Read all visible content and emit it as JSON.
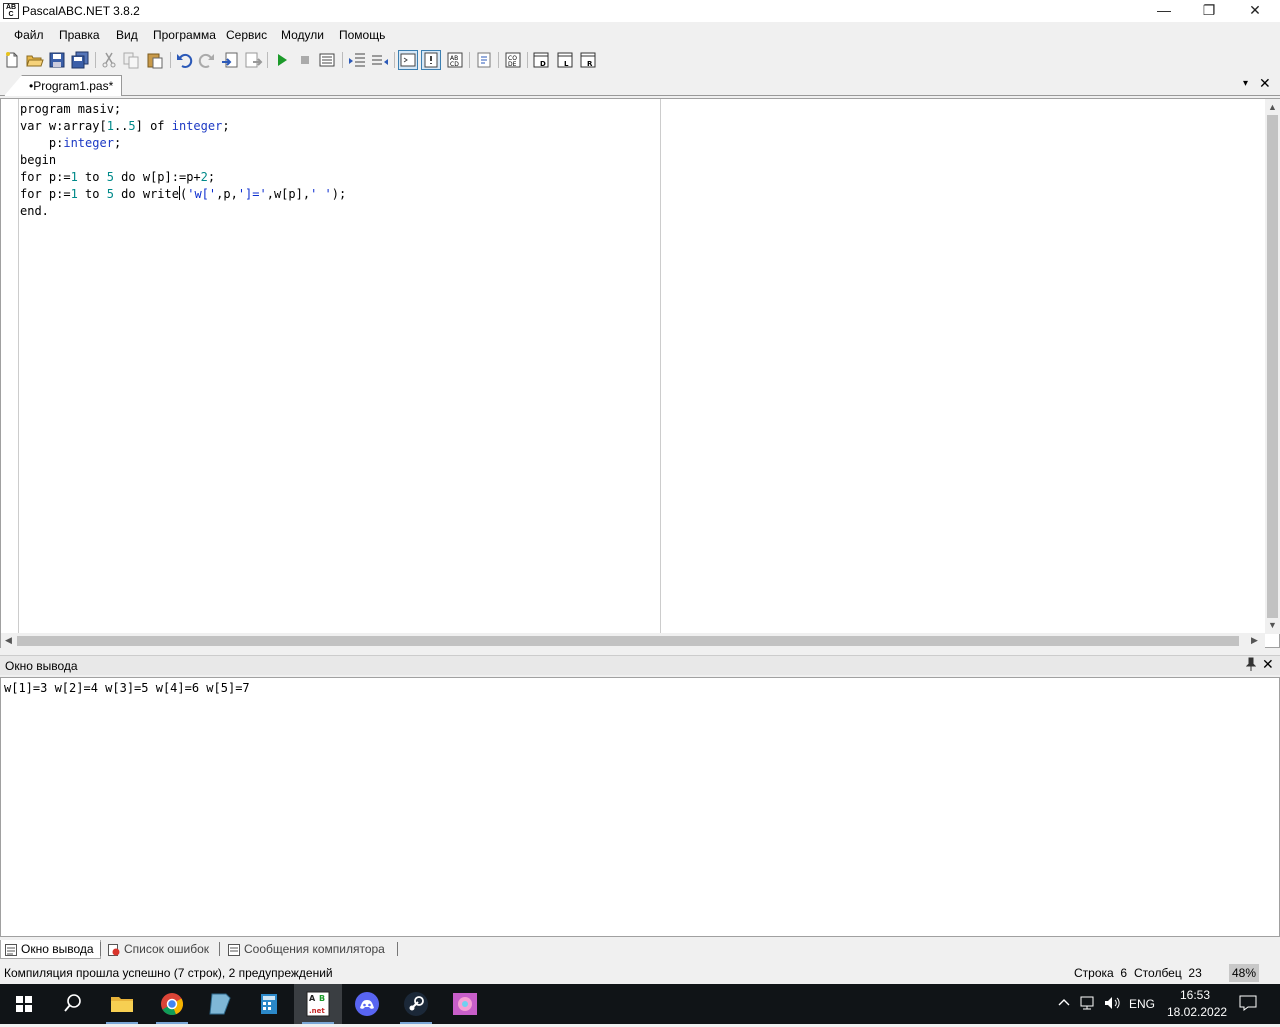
{
  "window": {
    "title": "PascalABC.NET 3.8.2",
    "logo_text": "AB C",
    "minimize": "—",
    "maximize": "❐",
    "close": "✕"
  },
  "menu": [
    "Файл",
    "Правка",
    "Вид",
    "Программа",
    "Сервис",
    "Модули",
    "Помощь"
  ],
  "toolbar_icons": [
    "new-file-icon",
    "open-icon",
    "save-icon",
    "save-all-icon",
    "cut-icon",
    "copy-icon",
    "paste-icon",
    "undo-icon",
    "redo-icon",
    "find-icon",
    "replace-icon",
    "run-icon",
    "stop-icon",
    "debug-icon",
    "step-into-icon",
    "step-over-icon",
    "output-window-icon",
    "error-list-icon",
    "compiler-messages-icon",
    "format-icon",
    "code-template-icon",
    "form-icon",
    "designer-icon",
    "reference-icon"
  ],
  "editor": {
    "tab_label": "•Program1.pas*",
    "tab_menu_arrow": "▾",
    "tab_close": "✕",
    "lines": {
      "l1": "program masiv;",
      "l2_a": "var w:array[",
      "l2_n1": "1",
      "l2_b": "..",
      "l2_n2": "5",
      "l2_c": "] of ",
      "l2_type": "integer",
      "l2_d": ";",
      "l3_a": "    p:",
      "l3_type": "integer",
      "l3_b": ";",
      "l4": "begin",
      "l5_a": "for p:=",
      "l5_n1": "1",
      "l5_b": " to ",
      "l5_n2": "5",
      "l5_c": " do w[p]:=p+",
      "l5_n3": "2",
      "l5_d": ";",
      "l6_a": "for p:=",
      "l6_n1": "1",
      "l6_b": " to ",
      "l6_n2": "5",
      "l6_c": " do write",
      "l6_d": "(",
      "l6_s1": "'w['",
      "l6_e": ",p,",
      "l6_s2": "']='",
      "l6_f": ",w[p],",
      "l6_s3": "' '",
      "l6_g": ");",
      "l7": "end."
    }
  },
  "output": {
    "title": "Окно вывода",
    "pin": "📌",
    "close": "✕",
    "text": "w[1]=3 w[2]=4 w[3]=5 w[4]=6 w[5]=7"
  },
  "bottom_tabs": {
    "output": "Окно вывода",
    "errors": "Список ошибок",
    "compiler": "Сообщения компилятора"
  },
  "status": {
    "message": "Компиляция прошла успешно (7 строк), 2 предупреждений",
    "row_label": "Строка",
    "row_value": "6",
    "col_label": "Столбец",
    "col_value": "23",
    "zoom": "48%"
  },
  "taskbar": {
    "lang": "ENG",
    "time": "16:53",
    "date": "18.02.2022",
    "up_arrow": "^"
  },
  "colors": {
    "keyword_type": "#1c39c4",
    "number": "#008a8a",
    "string": "#0d2ecf",
    "taskbar": "#101417"
  }
}
